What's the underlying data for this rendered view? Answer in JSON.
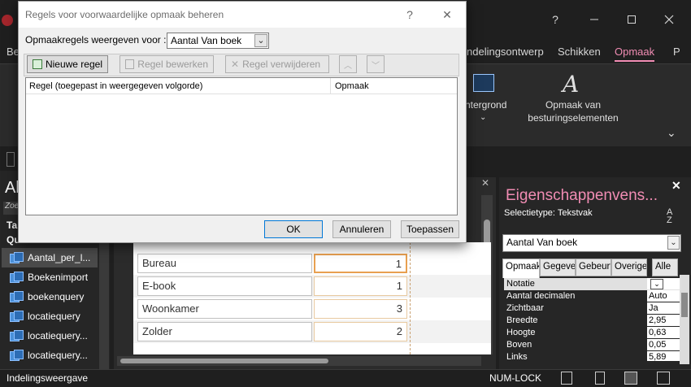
{
  "titlebar": {
    "app_icon": "access-icon",
    "help_label": "?",
    "minimize_icon": "minimize-icon",
    "maximize_icon": "maximize-icon",
    "close_icon": "close-icon"
  },
  "ribbon": {
    "tabs": [
      {
        "label": "Be"
      },
      {
        "label": "ndelingsontwerp"
      },
      {
        "label": "Schikken"
      },
      {
        "label": "Opmaak"
      },
      {
        "label": "P"
      }
    ],
    "group_background_label": "chtergrond",
    "group_control_format_line1": "Opmaak van",
    "group_control_format_line2": "besturingselementen"
  },
  "nav": {
    "title": "Al",
    "search_placeholder": "Zoe",
    "section_tables": "Ta",
    "section_queries": "Qu",
    "items": [
      {
        "label": "Aantal_per_l..."
      },
      {
        "label": "Boekenimport"
      },
      {
        "label": "boekenquery"
      },
      {
        "label": "locatiequery"
      },
      {
        "label": "locatiequery..."
      },
      {
        "label": "locatiequery..."
      }
    ]
  },
  "report": {
    "rows": [
      {
        "label": "Bureau",
        "value": "1"
      },
      {
        "label": "E-book",
        "value": "1"
      },
      {
        "label": "Woonkamer",
        "value": "3"
      },
      {
        "label": "Zolder",
        "value": "2"
      }
    ]
  },
  "property_sheet": {
    "title": "Eigenschappenvens...",
    "selection_type_label": "Selectietype:",
    "selection_type_value": "Tekstvak",
    "sort_icon": "sort-az-icon",
    "selected_control": "Aantal Van boek",
    "tabs": [
      {
        "label": "Opmaak"
      },
      {
        "label": "Gegever"
      },
      {
        "label": "Gebeurt"
      },
      {
        "label": "Overige"
      },
      {
        "label": "Alle"
      }
    ],
    "properties": [
      {
        "key": "Notatie",
        "value": ""
      },
      {
        "key": "Aantal decimalen",
        "value": "Auto"
      },
      {
        "key": "Zichtbaar",
        "value": "Ja"
      },
      {
        "key": "Breedte",
        "value": "2,95"
      },
      {
        "key": "Hoogte",
        "value": "0,63"
      },
      {
        "key": "Boven",
        "value": "0,05"
      },
      {
        "key": "Links",
        "value": "5,89"
      }
    ]
  },
  "statusbar": {
    "left_text": "Indelingsweergave",
    "numlock": "NUM-LOCK"
  },
  "dialog": {
    "title": "Regels voor voorwaardelijke opmaak beheren",
    "help": "?",
    "show_rules_label": "Opmaakregels weergeven voor :",
    "show_rules_value": "Aantal Van boek",
    "new_rule": "Nieuwe regel",
    "edit_rule": "Regel bewerken",
    "delete_rule": "Regel verwijderen",
    "col_rule": "Regel (toegepast in weergegeven volgorde)",
    "col_format": "Opmaak",
    "ok": "OK",
    "cancel": "Annuleren",
    "apply": "Toepassen"
  }
}
